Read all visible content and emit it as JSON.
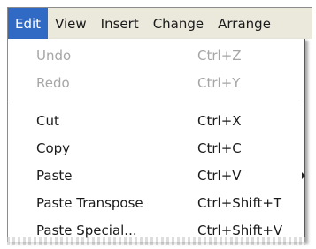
{
  "menubar": {
    "items": [
      {
        "label": "Edit"
      },
      {
        "label": "View"
      },
      {
        "label": "Insert"
      },
      {
        "label": "Change"
      },
      {
        "label": "Arrange"
      }
    ]
  },
  "menu": {
    "items": [
      {
        "label": "Undo",
        "shortcut": "Ctrl+Z"
      },
      {
        "label": "Redo",
        "shortcut": "Ctrl+Y"
      },
      {
        "label": "Cut",
        "shortcut": "Ctrl+X"
      },
      {
        "label": "Copy",
        "shortcut": "Ctrl+C"
      },
      {
        "label": "Paste",
        "shortcut": "Ctrl+V"
      },
      {
        "label": "Paste Transpose",
        "shortcut": "Ctrl+Shift+T"
      },
      {
        "label": "Paste Special...",
        "shortcut": "Ctrl+Shift+V"
      }
    ]
  },
  "colors": {
    "menubar_bg": "#ebe8dc",
    "highlight": "#316ac5",
    "disabled_text": "#a6a6a6"
  }
}
